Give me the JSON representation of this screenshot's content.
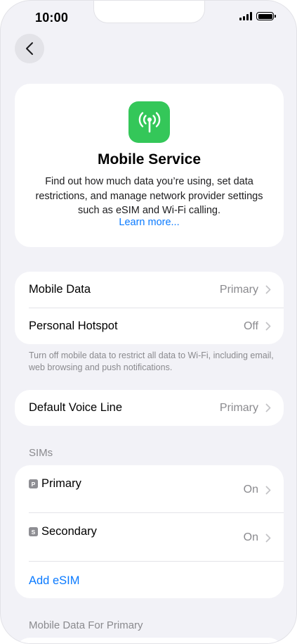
{
  "status_bar": {
    "time": "10:00"
  },
  "hero": {
    "title": "Mobile Service",
    "description": "Find out how much data you’re using, set data restrictions, and manage network provider settings such as eSIM and Wi-Fi calling.",
    "link": "Learn more..."
  },
  "data_group": {
    "rows": [
      {
        "label": "Mobile Data",
        "value": "Primary"
      },
      {
        "label": "Personal Hotspot",
        "value": "Off"
      }
    ],
    "footnote": "Turn off mobile data to restrict all data to Wi-Fi, including email, web browsing and push notifications."
  },
  "voice_group": {
    "label": "Default Voice Line",
    "value": "Primary"
  },
  "sims": {
    "header": "SIMs",
    "items": [
      {
        "badge": "P",
        "label": "Primary",
        "value": "On"
      },
      {
        "badge": "S",
        "label": "Secondary",
        "value": "On"
      }
    ],
    "add_label": "Add eSIM"
  },
  "next_section": {
    "header": "Mobile Data For Primary"
  },
  "colors": {
    "accent": "#0a7aff",
    "icon_green": "#34c759",
    "background": "#f2f2f7"
  },
  "icons": {
    "back": "chevron-left-icon",
    "hero": "antenna-icon",
    "row": "chevron-right-icon"
  }
}
